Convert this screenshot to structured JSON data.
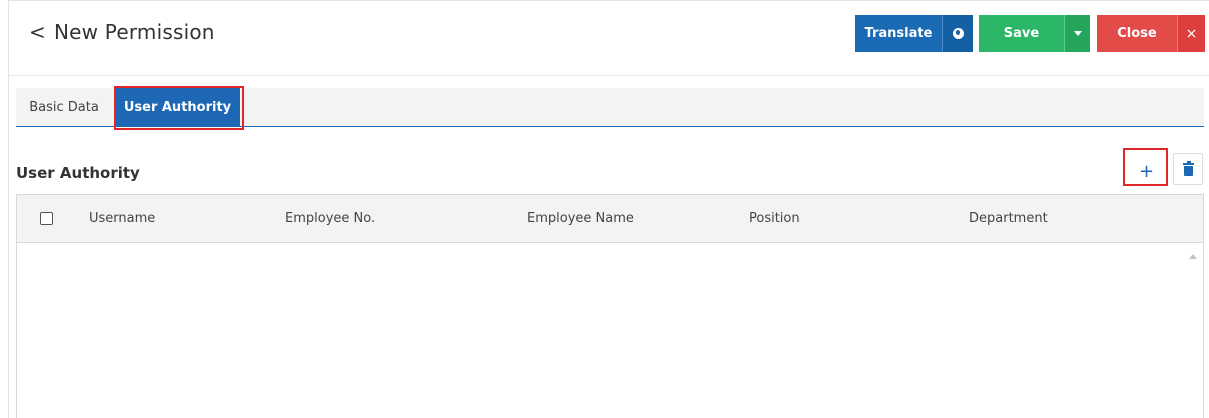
{
  "header": {
    "back_glyph": "<",
    "title": "New Permission"
  },
  "toolbar": {
    "translate_label": "Translate",
    "translate_icon": "globe-icon",
    "save_label": "Save",
    "save_dropdown_icon": "caret-down-icon",
    "close_label": "Close",
    "close_icon_glyph": "×"
  },
  "tabs": [
    {
      "label": "Basic Data",
      "active": false
    },
    {
      "label": "User Authority",
      "active": true
    }
  ],
  "section": {
    "title": "User Authority",
    "add_glyph": "+",
    "delete_icon": "trash-icon"
  },
  "table": {
    "columns": [
      "Username",
      "Employee No.",
      "Employee Name",
      "Position",
      "Department"
    ],
    "rows": []
  },
  "colors": {
    "primary": "#1d67b5",
    "success": "#2cb768",
    "danger": "#e34b49",
    "highlight": "#e02626"
  }
}
